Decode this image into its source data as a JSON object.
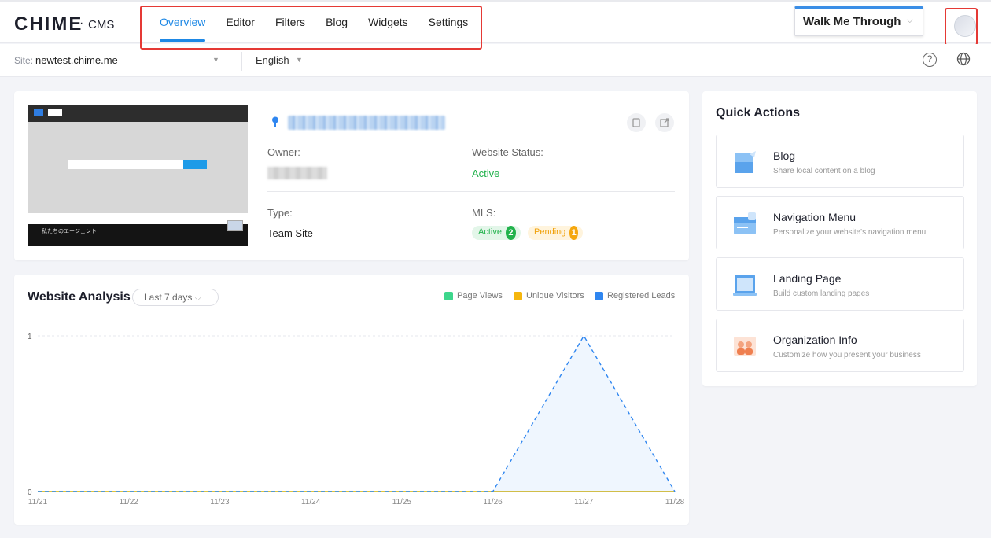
{
  "header": {
    "logo": "CHIME",
    "logo_separator": "·",
    "logo_suffix": "CMS",
    "tabs": [
      {
        "label": "Overview",
        "active": true
      },
      {
        "label": "Editor"
      },
      {
        "label": "Filters"
      },
      {
        "label": "Blog"
      },
      {
        "label": "Widgets"
      },
      {
        "label": "Settings"
      }
    ],
    "walk_me_through": "Walk Me Through",
    "accent_color": "#1e88e5"
  },
  "subbar": {
    "site_label": "Site:",
    "site_value": "newtest.chime.me",
    "language": "English"
  },
  "site_card": {
    "preview_footer_text": "私たちのエージェント",
    "owner_label": "Owner:",
    "status_label": "Website Status:",
    "status_value": "Active",
    "type_label": "Type:",
    "type_value": "Team Site",
    "mls_label": "MLS:",
    "mls_active_label": "Active",
    "mls_active_count": "2",
    "mls_pending_label": "Pending",
    "mls_pending_count": "1"
  },
  "analysis": {
    "title": "Website Analysis",
    "range": "Last 7 days",
    "legend": [
      {
        "label": "Page Views",
        "color": "#3dd68c"
      },
      {
        "label": "Unique Visitors",
        "color": "#f5b60e"
      },
      {
        "label": "Registered Leads",
        "color": "#2f86f0"
      }
    ]
  },
  "chart_data": {
    "type": "area",
    "x": [
      "11/21",
      "11/22",
      "11/23",
      "11/24",
      "11/25",
      "11/26",
      "11/27",
      "11/28"
    ],
    "series": [
      {
        "name": "Page Views",
        "values": [
          0,
          0,
          0,
          0,
          0,
          0,
          0,
          0
        ],
        "color": "#3dd68c"
      },
      {
        "name": "Unique Visitors",
        "values": [
          0,
          0,
          0,
          0,
          0,
          0,
          0,
          0
        ],
        "color": "#f5b60e"
      },
      {
        "name": "Registered Leads",
        "values": [
          0,
          0,
          0,
          0,
          0,
          0,
          1,
          0
        ],
        "color": "#2f86f0"
      }
    ],
    "yticks": [
      "0",
      "1"
    ],
    "ylim": [
      0,
      1
    ],
    "grid": true,
    "legend_position": "top-right"
  },
  "quick_actions": {
    "title": "Quick Actions",
    "items": [
      {
        "title": "Blog",
        "desc": "Share local content on a blog",
        "icon": "blog-icon"
      },
      {
        "title": "Navigation Menu",
        "desc": "Personalize your website's navigation menu",
        "icon": "navigation-menu-icon"
      },
      {
        "title": "Landing Page",
        "desc": "Build custom landing pages",
        "icon": "landing-page-icon"
      },
      {
        "title": "Organization Info",
        "desc": "Customize how you present your business",
        "icon": "organization-info-icon"
      }
    ]
  }
}
